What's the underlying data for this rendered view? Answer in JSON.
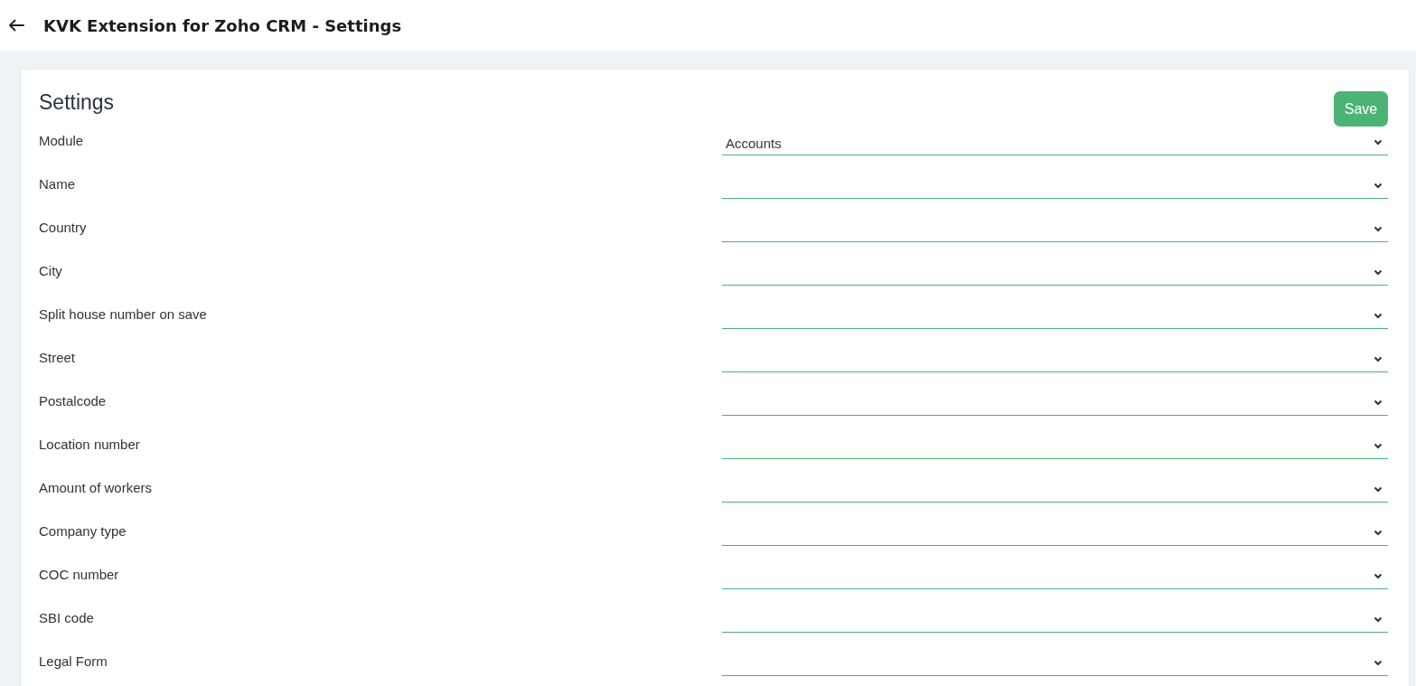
{
  "header": {
    "title": "KVK Extension for Zoho CRM - Settings"
  },
  "settings": {
    "title": "Settings",
    "save_button": "Save",
    "fields": [
      {
        "label": "Module",
        "value": "Accounts"
      },
      {
        "label": "Name"
      },
      {
        "label": "Country"
      },
      {
        "label": "City"
      },
      {
        "label": "Split house number on save"
      },
      {
        "label": "Street"
      },
      {
        "label": "Postalcode"
      },
      {
        "label": "Location number"
      },
      {
        "label": "Amount of workers"
      },
      {
        "label": "Company type"
      },
      {
        "label": "COC number"
      },
      {
        "label": "SBI code"
      },
      {
        "label": "Legal Form"
      }
    ]
  }
}
